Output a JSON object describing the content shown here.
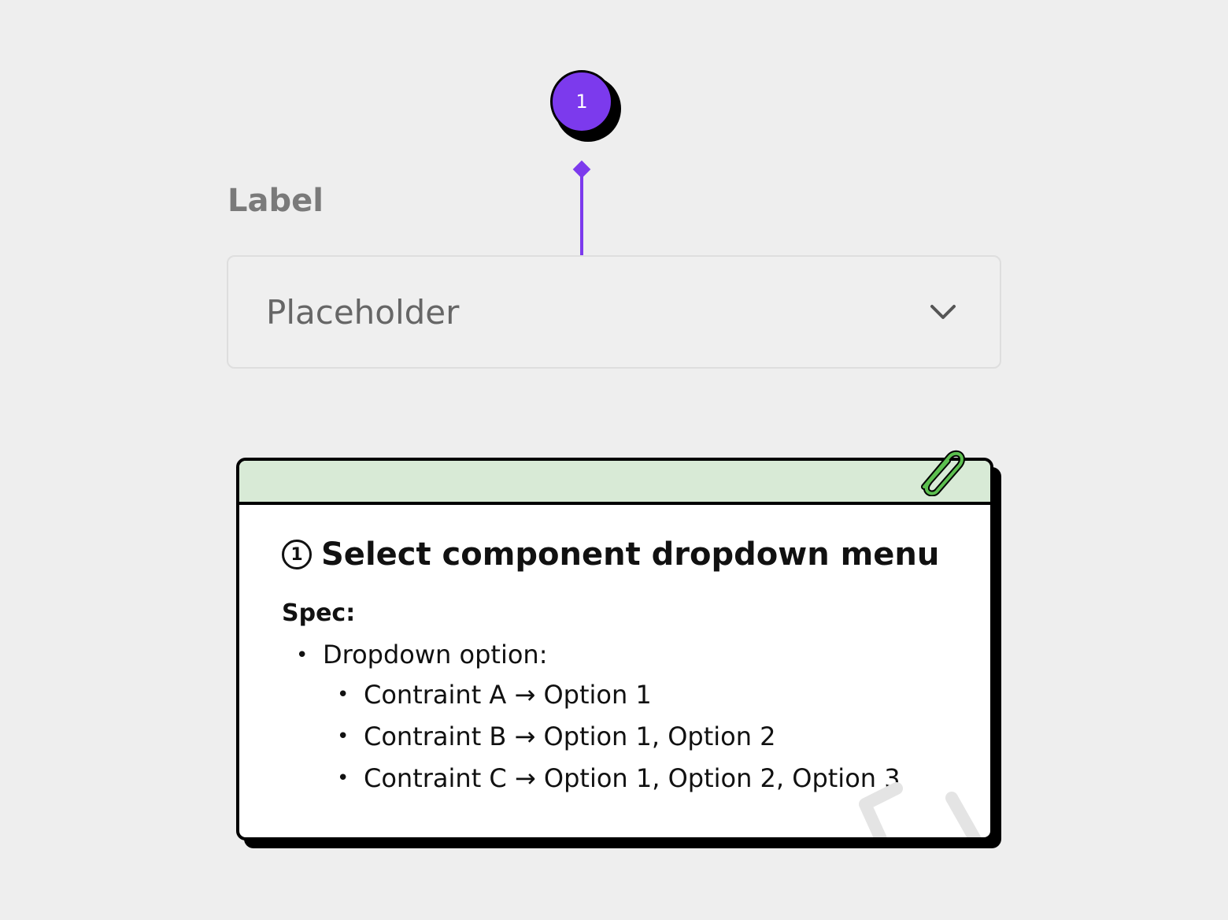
{
  "marker": {
    "number": "1"
  },
  "dropdown": {
    "label": "Label",
    "placeholder": "Placeholder"
  },
  "note": {
    "title_number": "1",
    "title": "Select component dropdown menu",
    "spec_heading": "Spec:",
    "items": [
      {
        "text": "Dropdown option:",
        "children": [
          "Contraint A → Option 1",
          "Contraint B → Option 1, Option 2",
          "Contraint C → Option 1, Option 2, Option 3"
        ]
      }
    ]
  },
  "colors": {
    "accent": "#7c3aed",
    "card_header": "#d8ead6",
    "background": "#eeeeee",
    "paperclip": "#5cbf4f"
  },
  "icons": [
    "chevron-down-icon",
    "paperclip-icon",
    "code-brackets-icon"
  ]
}
